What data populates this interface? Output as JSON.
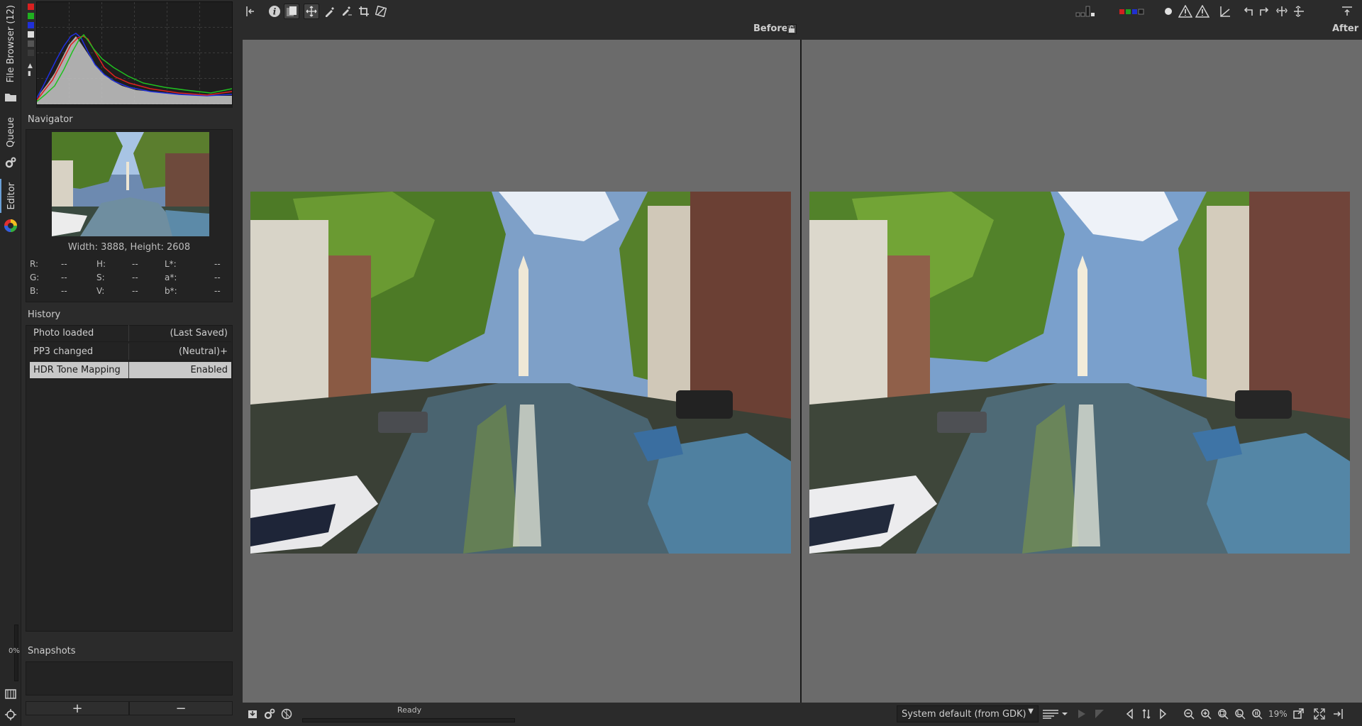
{
  "sidebar_tabs": {
    "file_browser": "File Browser (12)",
    "queue": "Queue",
    "editor": "Editor"
  },
  "progress": {
    "label": "0%",
    "value": 0
  },
  "navigator": {
    "title": "Navigator",
    "dimensions": "Width: 3888, Height: 2608",
    "values": [
      [
        {
          "k": "R:",
          "v": "--"
        },
        {
          "k": "H:",
          "v": "--"
        },
        {
          "k": "L*:",
          "v": "--"
        }
      ],
      [
        {
          "k": "G:",
          "v": "--"
        },
        {
          "k": "S:",
          "v": "--"
        },
        {
          "k": "a*:",
          "v": "--"
        }
      ],
      [
        {
          "k": "B:",
          "v": "--"
        },
        {
          "k": "V:",
          "v": "--"
        },
        {
          "k": "b*:",
          "v": "--"
        }
      ]
    ]
  },
  "history": {
    "title": "History",
    "rows": [
      {
        "action": "Photo loaded",
        "value": "(Last Saved)",
        "selected": false
      },
      {
        "action": "PP3 changed",
        "value": "(Neutral)+",
        "selected": false
      },
      {
        "action": "HDR Tone Mapping",
        "value": "Enabled",
        "selected": true
      }
    ]
  },
  "snapshots": {
    "title": "Snapshots",
    "add_label": "+",
    "remove_label": "−"
  },
  "preview": {
    "before_label": "Before",
    "after_label": "After"
  },
  "status": {
    "text": "Ready",
    "profile": "System default (from GDK)",
    "zoom": "19%"
  },
  "colors": {
    "panel_bg": "#2b2b2b",
    "preview_bg": "#6b6b6b",
    "selected_row": "#c8c8c8",
    "histogram_red": "#e02020",
    "histogram_green": "#20c020",
    "histogram_blue": "#2030e0"
  }
}
